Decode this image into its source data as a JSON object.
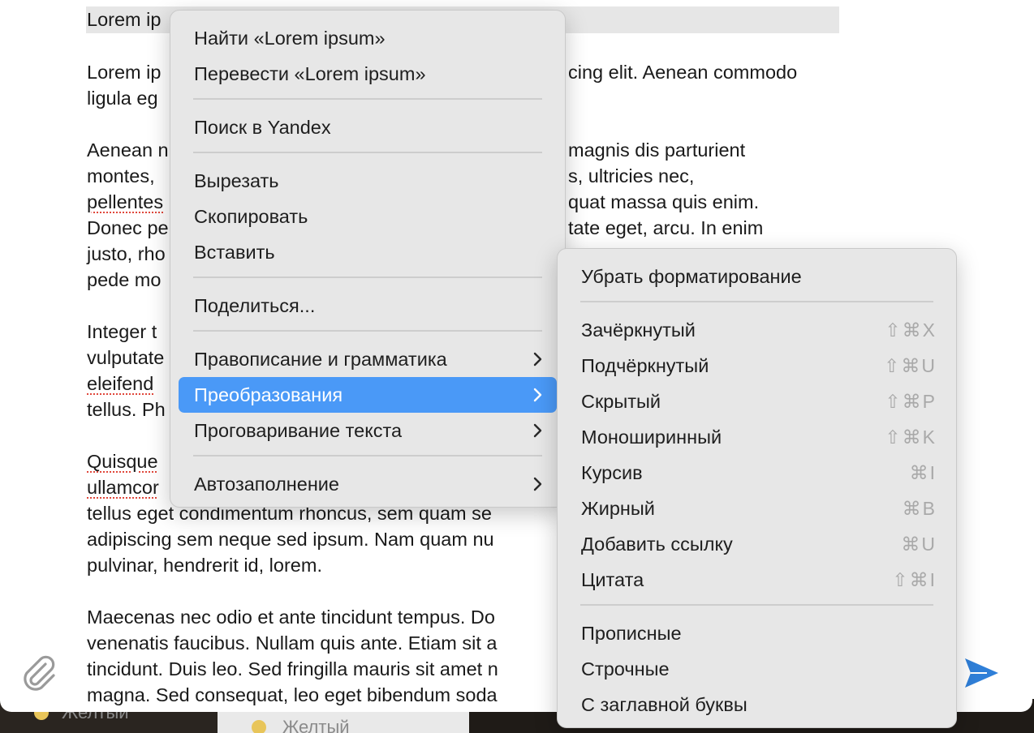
{
  "background_tags": {
    "left_label": "Желтый",
    "mid_label": "Желтый"
  },
  "editor": {
    "selected_line": "Lorem ip",
    "paragraphs": [
      [
        "Lorem ip",
        "ligula eg"
      ],
      [
        "Aenean n",
        "montes,",
        "pellentes",
        "Donec pe",
        "justo, rho",
        "pede mo"
      ],
      [
        "Integer t",
        "vulputate",
        "eleifend",
        "tellus. Ph"
      ],
      [
        "Quisque",
        "ullamcor",
        "tellus eget condimentum rhoncus, sem quam se",
        "adipiscing sem neque sed ipsum. Nam quam nu",
        "pulvinar, hendrerit id, lorem."
      ],
      [
        "Maecenas nec odio et ante tincidunt tempus. Do",
        "venenatis faucibus. Nullam quis ante. Etiam sit a",
        "tincidunt. Duis leo. Sed fringilla mauris sit amet n",
        "magna. Sed consequat, leo eget bibendum soda"
      ]
    ],
    "right_fragments": {
      "p1_l1": "cing elit. Aenean commodo",
      "p2_l1": "magnis dis parturient",
      "p2_l2": "s, ultricies nec,",
      "p2_l3": "quat massa quis enim.",
      "p2_l4": "tate eget, arcu. In enim"
    }
  },
  "context_menu": {
    "items": [
      {
        "label": "Найти «Lorem ipsum»"
      },
      {
        "label": "Перевести «Lorem ipsum»"
      },
      {
        "label": "Поиск в Yandex"
      },
      {
        "label": "Вырезать"
      },
      {
        "label": "Скопировать"
      },
      {
        "label": "Вставить"
      },
      {
        "label": "Поделиться..."
      },
      {
        "label": "Правописание и грамматика",
        "submenu": true
      },
      {
        "label": "Преобразования",
        "submenu": true,
        "active": true
      },
      {
        "label": "Проговаривание текста",
        "submenu": true
      },
      {
        "label": "Автозаполнение",
        "submenu": true
      }
    ]
  },
  "submenu": {
    "items": [
      {
        "label": "Убрать форматирование",
        "shortcut": ""
      },
      {
        "label": "Зачёркнутый",
        "shortcut": "⇧⌘X"
      },
      {
        "label": "Подчёркнутый",
        "shortcut": "⇧⌘U"
      },
      {
        "label": "Скрытый",
        "shortcut": "⇧⌘P"
      },
      {
        "label": "Моноширинный",
        "shortcut": "⇧⌘K"
      },
      {
        "label": "Курсив",
        "shortcut": "⌘I"
      },
      {
        "label": "Жирный",
        "shortcut": "⌘B"
      },
      {
        "label": "Добавить ссылку",
        "shortcut": "⌘U"
      },
      {
        "label": "Цитата",
        "shortcut": "⇧⌘I"
      },
      {
        "label": "Прописные",
        "shortcut": ""
      },
      {
        "label": "Строчные",
        "shortcut": ""
      },
      {
        "label": "С заглавной буквы",
        "shortcut": ""
      }
    ]
  },
  "icons": {
    "attach": "paperclip-icon",
    "send": "send-arrow-icon",
    "chevron": "chevron-right-icon"
  },
  "colors": {
    "accent": "#4a99f7",
    "send": "#2f7fd8",
    "spelling_underline": "#e0473b",
    "menu_bg": "#e7e7e7"
  }
}
